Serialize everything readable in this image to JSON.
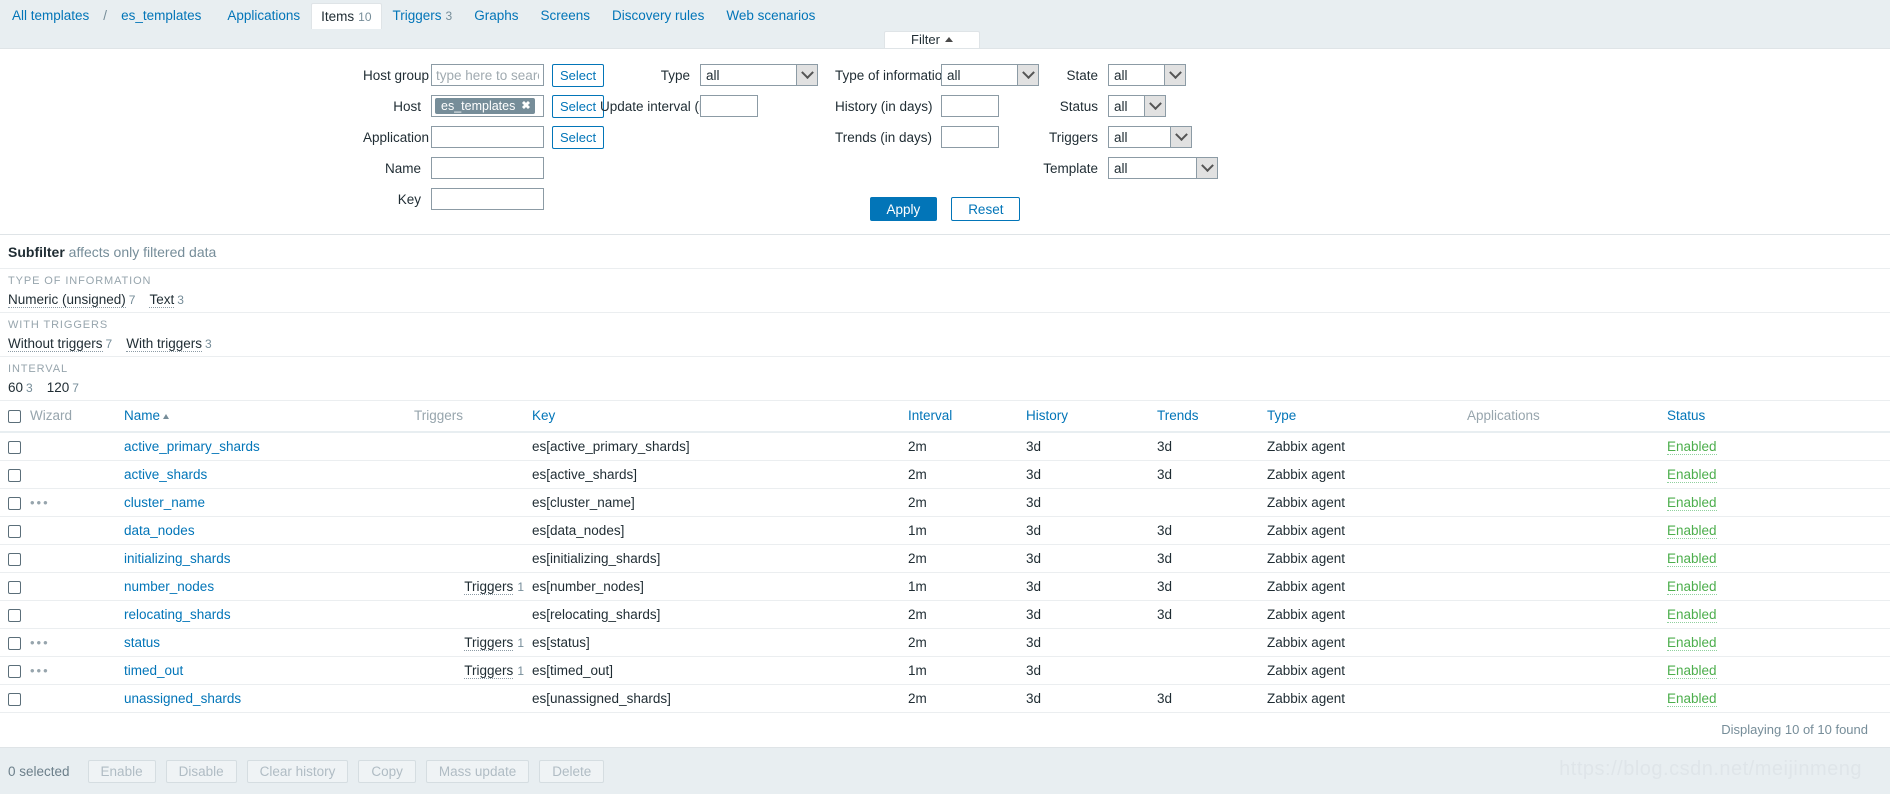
{
  "nav": {
    "breadcrumb_root": "All templates",
    "breadcrumb_sep": "/",
    "breadcrumb_current": "es_templates",
    "tabs": [
      {
        "label": "Applications",
        "count": "",
        "selected": false
      },
      {
        "label": "Items",
        "count": "10",
        "selected": true
      },
      {
        "label": "Triggers",
        "count": "3",
        "selected": false
      },
      {
        "label": "Graphs",
        "count": "",
        "selected": false
      },
      {
        "label": "Screens",
        "count": "",
        "selected": false
      },
      {
        "label": "Discovery rules",
        "count": "",
        "selected": false
      },
      {
        "label": "Web scenarios",
        "count": "",
        "selected": false
      }
    ]
  },
  "filter_tab": {
    "label": "Filter",
    "state": "expanded"
  },
  "filter": {
    "host_group": {
      "label": "Host group",
      "value": "",
      "placeholder": "type here to search",
      "select_label": "Select"
    },
    "host": {
      "label": "Host",
      "chip": "es_templates",
      "chip_remove": "✖",
      "select_label": "Select"
    },
    "application": {
      "label": "Application",
      "value": "",
      "select_label": "Select"
    },
    "name": {
      "label": "Name",
      "value": ""
    },
    "key": {
      "label": "Key",
      "value": ""
    },
    "type": {
      "label": "Type",
      "value": "all"
    },
    "update_interval": {
      "label": "Update interval (in sec)",
      "value": ""
    },
    "type_of_information": {
      "label": "Type of information",
      "value": "all"
    },
    "history": {
      "label": "History (in days)",
      "value": ""
    },
    "trends": {
      "label": "Trends (in days)",
      "value": ""
    },
    "state": {
      "label": "State",
      "value": "all"
    },
    "status": {
      "label": "Status",
      "value": "all"
    },
    "triggers": {
      "label": "Triggers",
      "value": "all"
    },
    "template": {
      "label": "Template",
      "value": "all"
    },
    "apply_label": "Apply",
    "reset_label": "Reset"
  },
  "subfilter": {
    "title": "Subfilter",
    "subtitle": "affects only filtered data",
    "groups": [
      {
        "title": "TYPE OF INFORMATION",
        "items": [
          {
            "label": "Numeric (unsigned)",
            "count": "7",
            "link": true
          },
          {
            "label": "Text",
            "count": "3",
            "link": true
          }
        ]
      },
      {
        "title": "WITH TRIGGERS",
        "items": [
          {
            "label": "Without triggers",
            "count": "7",
            "link": true
          },
          {
            "label": "With triggers",
            "count": "3",
            "link": true
          }
        ]
      },
      {
        "title": "INTERVAL",
        "items": [
          {
            "label": "60",
            "count": "3",
            "link": false
          },
          {
            "label": "120",
            "count": "7",
            "link": false
          }
        ]
      }
    ]
  },
  "table": {
    "columns": [
      {
        "key": "checkbox",
        "label": "",
        "sortable": false
      },
      {
        "key": "wizard",
        "label": "Wizard",
        "sortable": false
      },
      {
        "key": "name",
        "label": "Name",
        "sortable": true,
        "sorted": "asc"
      },
      {
        "key": "triggers",
        "label": "Triggers",
        "sortable": false
      },
      {
        "key": "item_key",
        "label": "Key",
        "sortable": true
      },
      {
        "key": "interval",
        "label": "Interval",
        "sortable": true
      },
      {
        "key": "history",
        "label": "History",
        "sortable": true
      },
      {
        "key": "trends",
        "label": "Trends",
        "sortable": true
      },
      {
        "key": "type",
        "label": "Type",
        "sortable": true
      },
      {
        "key": "applications",
        "label": "Applications",
        "sortable": false
      },
      {
        "key": "status",
        "label": "Status",
        "sortable": true
      }
    ],
    "rows": [
      {
        "wizard": "",
        "name": "active_primary_shards",
        "triggers_label": "",
        "triggers_count": "",
        "item_key": "es[active_primary_shards]",
        "interval": "2m",
        "history": "3d",
        "trends": "3d",
        "type": "Zabbix agent",
        "applications": "",
        "status": "Enabled"
      },
      {
        "wizard": "",
        "name": "active_shards",
        "triggers_label": "",
        "triggers_count": "",
        "item_key": "es[active_shards]",
        "interval": "2m",
        "history": "3d",
        "trends": "3d",
        "type": "Zabbix agent",
        "applications": "",
        "status": "Enabled"
      },
      {
        "wizard": "•••",
        "name": "cluster_name",
        "triggers_label": "",
        "triggers_count": "",
        "item_key": "es[cluster_name]",
        "interval": "2m",
        "history": "3d",
        "trends": "",
        "type": "Zabbix agent",
        "applications": "",
        "status": "Enabled"
      },
      {
        "wizard": "",
        "name": "data_nodes",
        "triggers_label": "",
        "triggers_count": "",
        "item_key": "es[data_nodes]",
        "interval": "1m",
        "history": "3d",
        "trends": "3d",
        "type": "Zabbix agent",
        "applications": "",
        "status": "Enabled"
      },
      {
        "wizard": "",
        "name": "initializing_shards",
        "triggers_label": "",
        "triggers_count": "",
        "item_key": "es[initializing_shards]",
        "interval": "2m",
        "history": "3d",
        "trends": "3d",
        "type": "Zabbix agent",
        "applications": "",
        "status": "Enabled"
      },
      {
        "wizard": "",
        "name": "number_nodes",
        "triggers_label": "Triggers",
        "triggers_count": "1",
        "item_key": "es[number_nodes]",
        "interval": "1m",
        "history": "3d",
        "trends": "3d",
        "type": "Zabbix agent",
        "applications": "",
        "status": "Enabled"
      },
      {
        "wizard": "",
        "name": "relocating_shards",
        "triggers_label": "",
        "triggers_count": "",
        "item_key": "es[relocating_shards]",
        "interval": "2m",
        "history": "3d",
        "trends": "3d",
        "type": "Zabbix agent",
        "applications": "",
        "status": "Enabled"
      },
      {
        "wizard": "•••",
        "name": "status",
        "triggers_label": "Triggers",
        "triggers_count": "1",
        "item_key": "es[status]",
        "interval": "2m",
        "history": "3d",
        "trends": "",
        "type": "Zabbix agent",
        "applications": "",
        "status": "Enabled"
      },
      {
        "wizard": "•••",
        "name": "timed_out",
        "triggers_label": "Triggers",
        "triggers_count": "1",
        "item_key": "es[timed_out]",
        "interval": "1m",
        "history": "3d",
        "trends": "",
        "type": "Zabbix agent",
        "applications": "",
        "status": "Enabled"
      },
      {
        "wizard": "",
        "name": "unassigned_shards",
        "triggers_label": "",
        "triggers_count": "",
        "item_key": "es[unassigned_shards]",
        "interval": "2m",
        "history": "3d",
        "trends": "3d",
        "type": "Zabbix agent",
        "applications": "",
        "status": "Enabled"
      }
    ],
    "footer_text": "Displaying 10 of 10 found"
  },
  "actionbar": {
    "selected_text": "0 selected",
    "buttons": [
      {
        "label": "Enable",
        "disabled": true
      },
      {
        "label": "Disable",
        "disabled": true
      },
      {
        "label": "Clear history",
        "disabled": true
      },
      {
        "label": "Copy",
        "disabled": true
      },
      {
        "label": "Mass update",
        "disabled": true
      },
      {
        "label": "Delete",
        "disabled": true
      }
    ]
  },
  "watermark": "https://blog.csdn.net/meijinmeng",
  "colors": {
    "accent": "#0275b8",
    "chrome": "#e8eef1",
    "status_enabled": "#4cae4c",
    "muted": "#768d99"
  }
}
